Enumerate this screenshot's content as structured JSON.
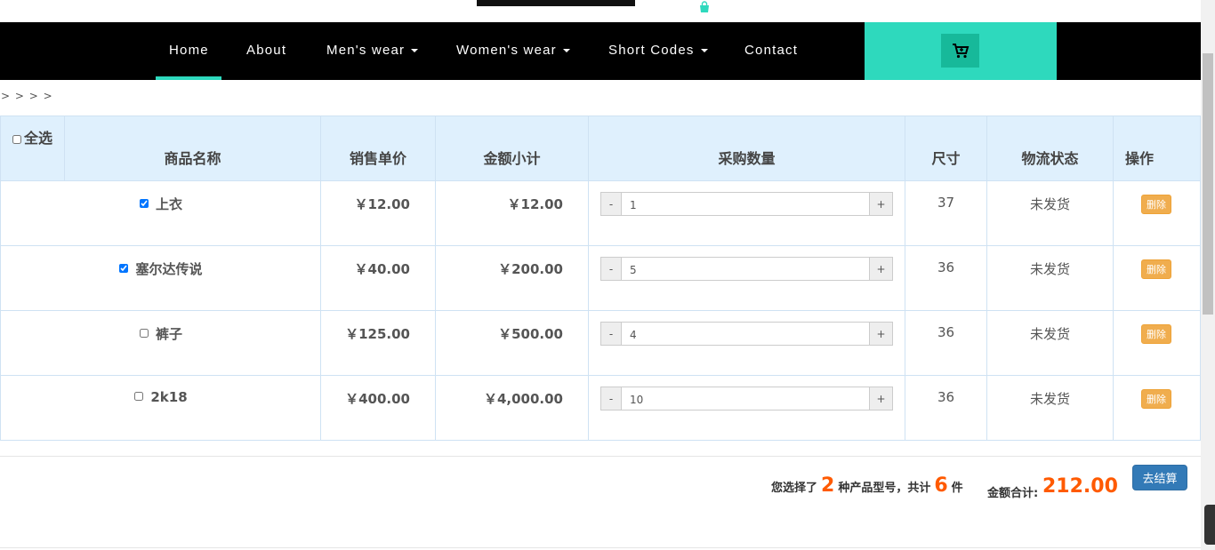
{
  "nav": {
    "items": [
      {
        "label": "Home",
        "dropdown": false
      },
      {
        "label": "About",
        "dropdown": false
      },
      {
        "label": "Men's wear",
        "dropdown": true
      },
      {
        "label": "Women's wear",
        "dropdown": true
      },
      {
        "label": "Short Codes",
        "dropdown": true
      },
      {
        "label": "Contact",
        "dropdown": false
      }
    ],
    "active": "Home",
    "cart_icon": "cart-icon",
    "bag_icon": "shopping-bag-icon"
  },
  "breadcrumb": "> > > >",
  "table": {
    "headers": {
      "select_all": "全选",
      "name": "商品名称",
      "unit_price": "销售单价",
      "subtotal": "金额小计",
      "quantity": "采购数量",
      "size": "尺寸",
      "shipping": "物流状态",
      "actions": "操作"
    },
    "rows": [
      {
        "name": "上衣",
        "checked": true,
        "unit_price": "￥12.00",
        "subtotal": "￥12.00",
        "qty": "1",
        "size": "37",
        "status": "未发货",
        "delete": "删除"
      },
      {
        "name": "塞尔达传说",
        "checked": true,
        "unit_price": "￥40.00",
        "subtotal": "￥200.00",
        "qty": "5",
        "size": "36",
        "status": "未发货",
        "delete": "删除"
      },
      {
        "name": "裤子",
        "checked": false,
        "unit_price": "￥125.00",
        "subtotal": "￥500.00",
        "qty": "4",
        "size": "36",
        "status": "未发货",
        "delete": "删除"
      },
      {
        "name": "2k18",
        "checked": false,
        "unit_price": "￥400.00",
        "subtotal": "￥4,000.00",
        "qty": "10",
        "size": "36",
        "status": "未发货",
        "delete": "删除"
      }
    ],
    "minus": "-",
    "plus": "+"
  },
  "summary": {
    "prefix": "您选择了",
    "types": "2",
    "mid": "种产品型号，共计",
    "count": "6",
    "suffix": "件",
    "total_label": "金额合计:",
    "total": "212.00",
    "checkout": "去结算"
  },
  "colors": {
    "accent": "#2ed9bd",
    "accent_dark": "#17b99a",
    "price": "#ff5a00",
    "delete": "#f0ad4e",
    "checkout": "#337ab7",
    "header_bg": "#dff0fd"
  }
}
